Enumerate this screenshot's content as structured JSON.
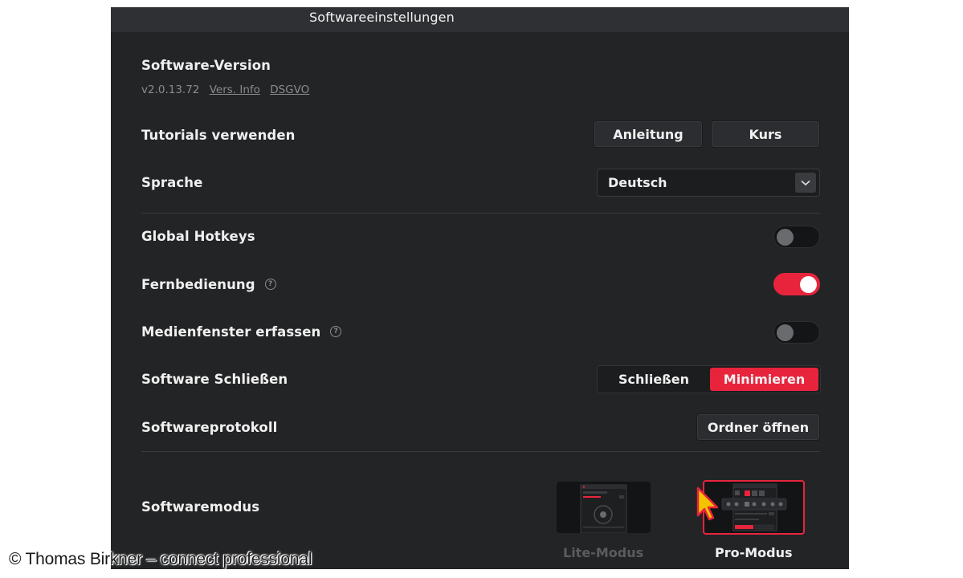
{
  "window": {
    "title": "Softwareeinstellungen"
  },
  "version": {
    "label": "Software-Version",
    "number": "v2.0.13.72",
    "info_link": "Vers. Info",
    "privacy_link": "DSGVO"
  },
  "tutorials": {
    "label": "Tutorials verwenden",
    "guide_button": "Anleitung",
    "course_button": "Kurs"
  },
  "language": {
    "label": "Sprache",
    "selected": "Deutsch"
  },
  "hotkeys": {
    "label": "Global Hotkeys",
    "enabled": false
  },
  "remote": {
    "label": "Fernbedienung",
    "enabled": true
  },
  "capture": {
    "label": "Medienfenster erfassen",
    "enabled": false
  },
  "close_behavior": {
    "label": "Software Schließen",
    "options": [
      "Schließen",
      "Minimieren"
    ],
    "selected": "Minimieren"
  },
  "log": {
    "label": "Softwareprotokoll",
    "button": "Ordner öffnen"
  },
  "mode": {
    "label": "Softwaremodus",
    "lite_label": "Lite-Modus",
    "pro_label": "Pro-Modus",
    "selected": "Pro-Modus"
  },
  "credit": "© Thomas Birkner – connect professional",
  "colors": {
    "accent": "#e8243d",
    "background": "#232426",
    "titlebar": "#2f3033"
  },
  "icons": {
    "help": "question-circle-icon",
    "dropdown": "chevron-down-icon",
    "cursor": "mouse-pointer-icon"
  }
}
